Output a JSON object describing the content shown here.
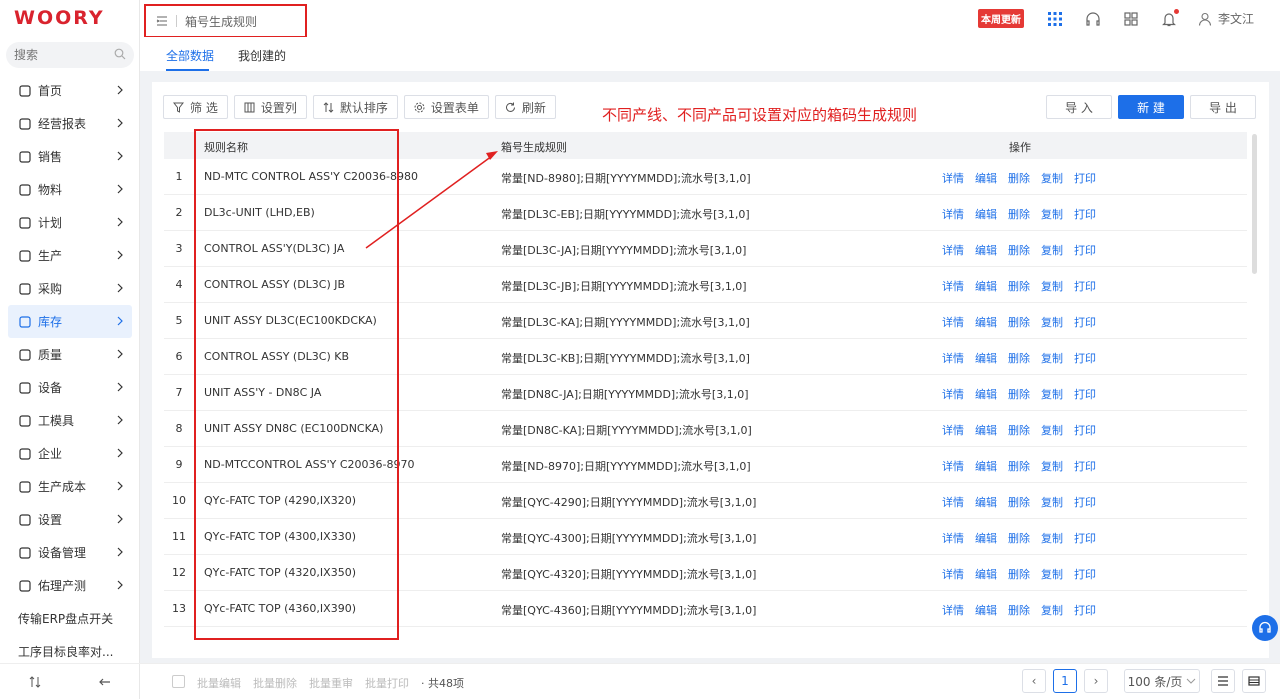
{
  "app": {
    "logo": "WOORY"
  },
  "search": {
    "placeholder": "搜索"
  },
  "sidebar": {
    "items": [
      {
        "label": "首页",
        "icon": "home-icon"
      },
      {
        "label": "经营报表",
        "icon": "report-icon"
      },
      {
        "label": "销售",
        "icon": "sales-icon"
      },
      {
        "label": "物料",
        "icon": "box-icon"
      },
      {
        "label": "计划",
        "icon": "clock-icon"
      },
      {
        "label": "生产",
        "icon": "wrench-icon"
      },
      {
        "label": "采购",
        "icon": "cart-icon"
      },
      {
        "label": "库存",
        "icon": "warehouse-icon",
        "active": true
      },
      {
        "label": "质量",
        "icon": "shield-icon"
      },
      {
        "label": "设备",
        "icon": "device-icon"
      },
      {
        "label": "工模具",
        "icon": "tool-icon"
      },
      {
        "label": "企业",
        "icon": "building-icon"
      },
      {
        "label": "生产成本",
        "icon": "cost-icon"
      },
      {
        "label": "设置",
        "icon": "gear-icon"
      },
      {
        "label": "设备管理",
        "icon": "device-manage-icon"
      },
      {
        "label": "佑理产测",
        "icon": "test-icon"
      },
      {
        "label": "传输ERP盘点开关",
        "icon": ""
      },
      {
        "label": "工序目标良率对...",
        "icon": ""
      }
    ]
  },
  "header": {
    "breadcrumb": "箱号生成规则",
    "badge": "本周更新",
    "user": "李文江"
  },
  "tabs": [
    {
      "label": "全部数据",
      "active": true
    },
    {
      "label": "我创建的",
      "active": false
    }
  ],
  "toolbar": {
    "filter": "筛 选",
    "columns": "设置列",
    "sort": "默认排序",
    "form": "设置表单",
    "refresh": "刷新",
    "import": "导 入",
    "new": "新 建",
    "export": "导 出"
  },
  "annotation": "不同产线、不同产品可设置对应的箱码生成规则",
  "table": {
    "headers": {
      "name": "规则名称",
      "rule": "箱号生成规则",
      "ops": "操作"
    },
    "ops": [
      "详情",
      "编辑",
      "删除",
      "复制",
      "打印"
    ],
    "rows": [
      {
        "idx": "1",
        "name": "ND-MTC CONTROL ASS'Y C20036-8980",
        "rule": "常量[ND-8980];日期[YYYYMMDD];流水号[3,1,0]"
      },
      {
        "idx": "2",
        "name": "DL3c-UNIT (LHD,EB)",
        "rule": "常量[DL3C-EB];日期[YYYYMMDD];流水号[3,1,0]"
      },
      {
        "idx": "3",
        "name": "CONTROL ASS'Y(DL3C) JA",
        "rule": "常量[DL3C-JA];日期[YYYYMMDD];流水号[3,1,0]"
      },
      {
        "idx": "4",
        "name": "CONTROL ASSY (DL3C) JB",
        "rule": "常量[DL3C-JB];日期[YYYYMMDD];流水号[3,1,0]"
      },
      {
        "idx": "5",
        "name": "UNIT ASSY DL3C(EC100KDCKA)",
        "rule": "常量[DL3C-KA];日期[YYYYMMDD];流水号[3,1,0]"
      },
      {
        "idx": "6",
        "name": "CONTROL ASSY (DL3C) KB",
        "rule": "常量[DL3C-KB];日期[YYYYMMDD];流水号[3,1,0]"
      },
      {
        "idx": "7",
        "name": "UNIT ASS'Y - DN8C JA",
        "rule": "常量[DN8C-JA];日期[YYYYMMDD];流水号[3,1,0]"
      },
      {
        "idx": "8",
        "name": "UNIT ASSY DN8C (EC100DNCKA)",
        "rule": "常量[DN8C-KA];日期[YYYYMMDD];流水号[3,1,0]"
      },
      {
        "idx": "9",
        "name": "ND-MTCCONTROL ASS'Y C20036-8970",
        "rule": "常量[ND-8970];日期[YYYYMMDD];流水号[3,1,0]"
      },
      {
        "idx": "10",
        "name": "QYc-FATC TOP (4290,IX320)",
        "rule": "常量[QYC-4290];日期[YYYYMMDD];流水号[3,1,0]"
      },
      {
        "idx": "11",
        "name": "QYc-FATC TOP (4300,IX330)",
        "rule": "常量[QYC-4300];日期[YYYYMMDD];流水号[3,1,0]"
      },
      {
        "idx": "12",
        "name": "QYc-FATC TOP (4320,IX350)",
        "rule": "常量[QYC-4320];日期[YYYYMMDD];流水号[3,1,0]"
      },
      {
        "idx": "13",
        "name": "QYc-FATC TOP (4360,IX390)",
        "rule": "常量[QYC-4360];日期[YYYYMMDD];流水号[3,1,0]"
      }
    ]
  },
  "footer": {
    "batch_edit": "批量编辑",
    "batch_delete": "批量删除",
    "batch_recalc": "批量重审",
    "batch_print": "批量打印",
    "total": "· 共48项",
    "prev": "‹",
    "page": "1",
    "next": "›",
    "page_size": "100 条/页"
  },
  "colors": {
    "accent": "#1d6fe8",
    "annotation": "#e02020"
  }
}
